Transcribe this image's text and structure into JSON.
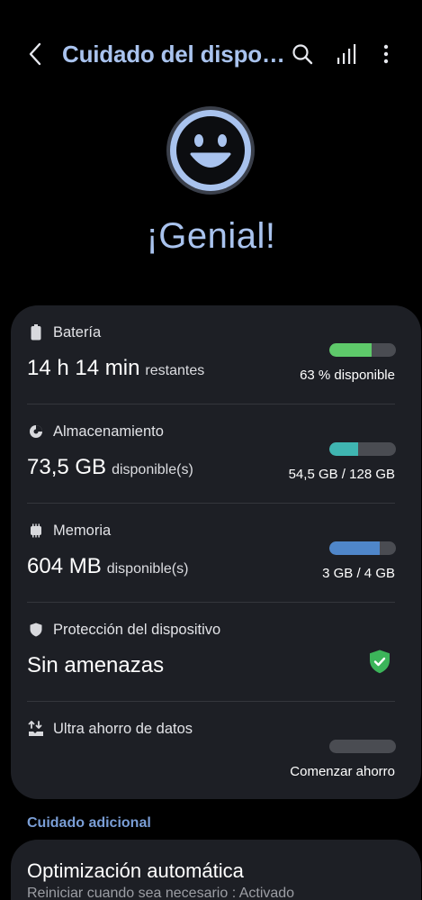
{
  "header": {
    "title": "Cuidado del dispo…",
    "icons": {
      "back": "chevron-left-icon",
      "search": "search-icon",
      "signal": "signal-bars-icon",
      "more": "more-vertical-icon"
    }
  },
  "hero": {
    "status": "¡Genial!",
    "icon": "smiley-face-icon"
  },
  "colors": {
    "accent": "#a9c3ee",
    "battery": "#5ec96a",
    "storage": "#3fb5b1",
    "memory": "#4f86c9",
    "shield_ok": "#3cb55a",
    "card_bg": "#1d1f25"
  },
  "battery": {
    "label": "Batería",
    "value": "14 h 14 min",
    "suffix": "restantes",
    "right": "63 % disponible",
    "fill_pct": 63
  },
  "storage": {
    "label": "Almacenamiento",
    "value": "73,5 GB",
    "suffix": "disponible(s)",
    "right": "54,5 GB / 128 GB",
    "fill_pct": 43
  },
  "memory": {
    "label": "Memoria",
    "value": "604 MB",
    "suffix": "disponible(s)",
    "right": "3 GB / 4 GB",
    "fill_pct": 75
  },
  "protection": {
    "label": "Protección del dispositivo",
    "value": "Sin amenazas"
  },
  "data_saver": {
    "label": "Ultra ahorro de datos",
    "right": "Comenzar ahorro",
    "fill_pct": 0
  },
  "additional": {
    "section_label": "Cuidado adicional",
    "auto_opt_title": "Optimización automática",
    "auto_opt_sub": "Reiniciar cuando sea necesario : Activado"
  }
}
